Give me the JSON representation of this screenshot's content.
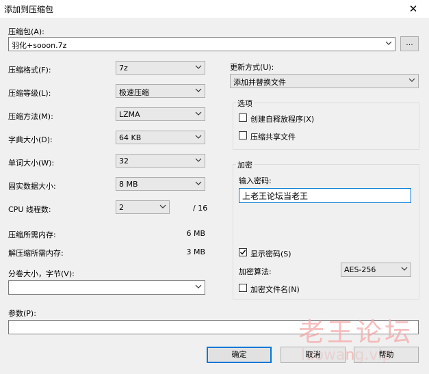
{
  "window": {
    "title": "添加到压缩包",
    "close_glyph": "✕"
  },
  "archive": {
    "label": "压缩包(A):",
    "value": "羽化+sooon.7z",
    "browse_label": "..."
  },
  "left": {
    "format": {
      "label": "压缩格式(F):",
      "value": "7z"
    },
    "level": {
      "label": "压缩等级(L):",
      "value": "极速压缩"
    },
    "method": {
      "label": "压缩方法(M):",
      "value": "LZMA"
    },
    "dict": {
      "label": "字典大小(D):",
      "value": "64 KB"
    },
    "word": {
      "label": "单词大小(W):",
      "value": "32"
    },
    "solid": {
      "label": "固实数据大小:",
      "value": "8 MB"
    },
    "cpu": {
      "label": "CPU 线程数:",
      "value": "2",
      "total": "/ 16"
    },
    "mem_comp": {
      "label": "压缩所需内存:",
      "value": "6 MB"
    },
    "mem_decomp": {
      "label": "解压缩所需内存:",
      "value": "3 MB"
    },
    "volume": {
      "label": "分卷大小，字节(V):",
      "value": ""
    }
  },
  "params": {
    "label": "参数(P):",
    "value": ""
  },
  "right": {
    "update": {
      "label": "更新方式(U):",
      "value": "添加并替换文件"
    },
    "options": {
      "title": "选项",
      "sfx": {
        "label": "创建自释放程序(X)",
        "checked": false
      },
      "shared": {
        "label": "压缩共享文件",
        "checked": false
      }
    },
    "encryption": {
      "title": "加密",
      "password_label": "输入密码:",
      "password_value": "上老王论坛当老王",
      "show_password": {
        "label": "显示密码(S)",
        "checked": true
      },
      "method_label": "加密算法:",
      "method_value": "AES-256",
      "encrypt_names": {
        "label": "加密文件名(N)",
        "checked": false
      }
    }
  },
  "buttons": {
    "ok": "确定",
    "cancel": "取消",
    "help": "帮助"
  },
  "watermark": {
    "cn": "老王论坛",
    "en": "laowang.vip"
  },
  "colors": {
    "accent": "#0078d7",
    "watermark": "#f4a9a9"
  }
}
